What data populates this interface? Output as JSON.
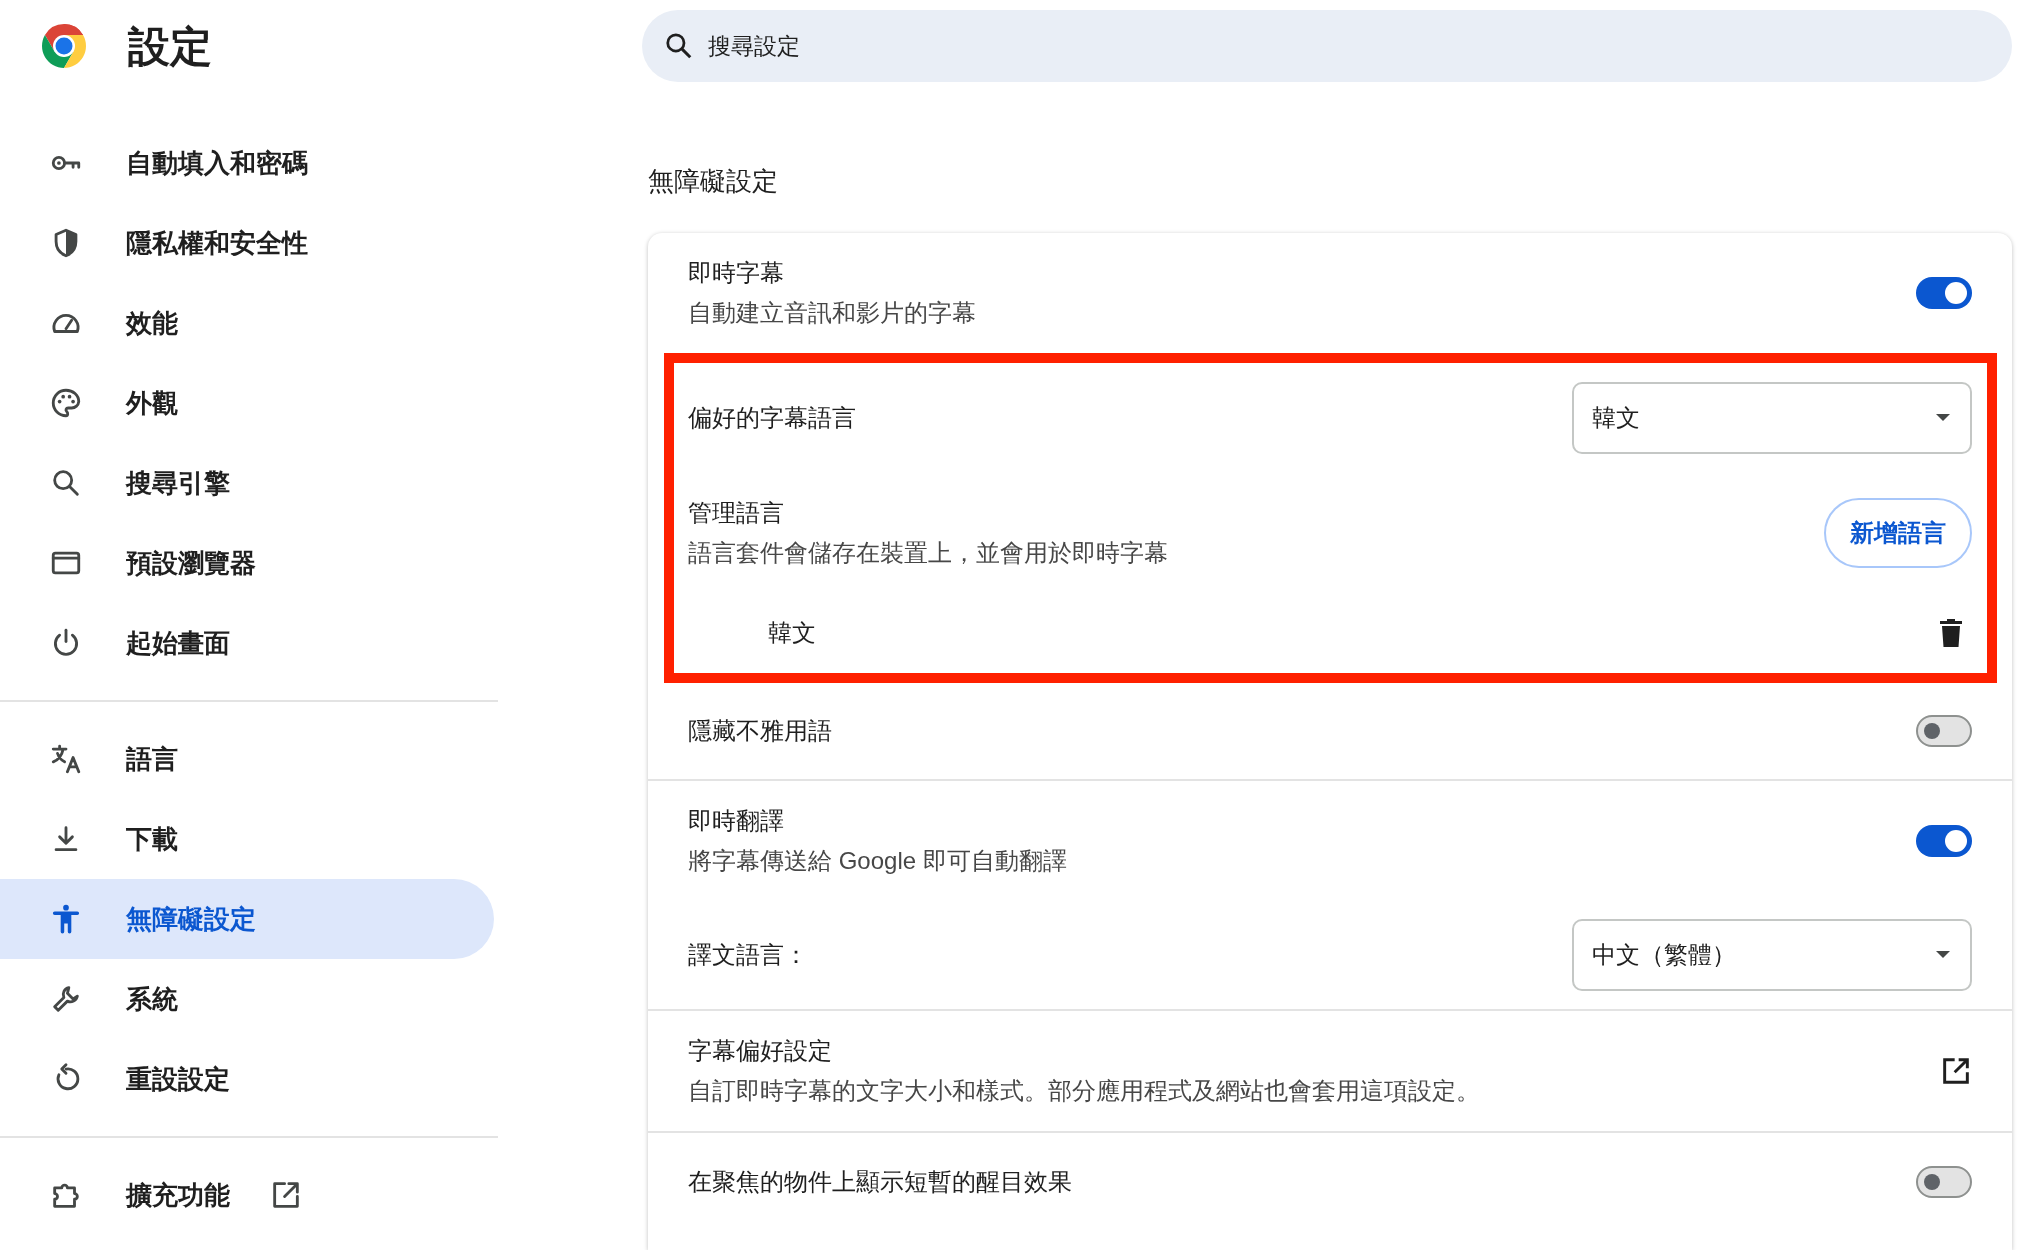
{
  "header": {
    "title": "設定"
  },
  "search": {
    "placeholder": "搜尋設定"
  },
  "sidebar": {
    "groups": [
      {
        "items": [
          {
            "label": "自動填入和密碼",
            "selected": false,
            "external_link": false
          },
          {
            "label": "隱私權和安全性",
            "selected": false,
            "external_link": false
          },
          {
            "label": "效能",
            "selected": false,
            "external_link": false
          },
          {
            "label": "外觀",
            "selected": false,
            "external_link": false
          },
          {
            "label": "搜尋引擎",
            "selected": false,
            "external_link": false
          },
          {
            "label": "預設瀏覽器",
            "selected": false,
            "external_link": false
          },
          {
            "label": "起始畫面",
            "selected": false,
            "external_link": false
          }
        ]
      },
      {
        "items": [
          {
            "label": "語言",
            "selected": false,
            "external_link": false
          },
          {
            "label": "下載",
            "selected": false,
            "external_link": false
          },
          {
            "label": "無障礙設定",
            "selected": true,
            "external_link": false
          },
          {
            "label": "系統",
            "selected": false,
            "external_link": false
          },
          {
            "label": "重設設定",
            "selected": false,
            "external_link": false
          }
        ]
      },
      {
        "items": [
          {
            "label": "擴充功能",
            "selected": false,
            "external_link": true
          }
        ]
      }
    ]
  },
  "section_title": "無障礙設定",
  "card": {
    "rows": [
      {
        "kind": "toggle",
        "title": "即時字幕",
        "subtitle": "自動建立音訊和影片的字幕",
        "on": true,
        "highlighted": false,
        "divider_after": false
      },
      {
        "kind": "select",
        "title": "偏好的字幕語言",
        "value": "韓文",
        "highlighted": true,
        "divider_after": false
      },
      {
        "kind": "button",
        "title": "管理語言",
        "subtitle": "語言套件會儲存在裝置上，並會用於即時字幕",
        "button": "新增語言",
        "highlighted": true,
        "divider_after": false
      },
      {
        "kind": "language",
        "title": "韓文",
        "highlighted": true,
        "divider_after": false
      },
      {
        "kind": "toggle",
        "title": "隱藏不雅用語",
        "on": false,
        "highlighted": false,
        "divider_after": true
      },
      {
        "kind": "toggle",
        "title": "即時翻譯",
        "subtitle": "將字幕傳送給 Google 即可自動翻譯",
        "on": true,
        "highlighted": false,
        "divider_after": false
      },
      {
        "kind": "select",
        "title": "譯文語言：",
        "value": "中文（繁體）",
        "highlighted": false,
        "divider_after": true
      },
      {
        "kind": "link",
        "title": "字幕偏好設定",
        "subtitle": "自訂即時字幕的文字大小和樣式。部分應用程式及網站也會套用這項設定。",
        "highlighted": false,
        "divider_after": true
      },
      {
        "kind": "toggle",
        "title": "在聚焦的物件上顯示短暫的醒目效果",
        "on": false,
        "highlighted": false,
        "divider_after": false
      }
    ]
  }
}
